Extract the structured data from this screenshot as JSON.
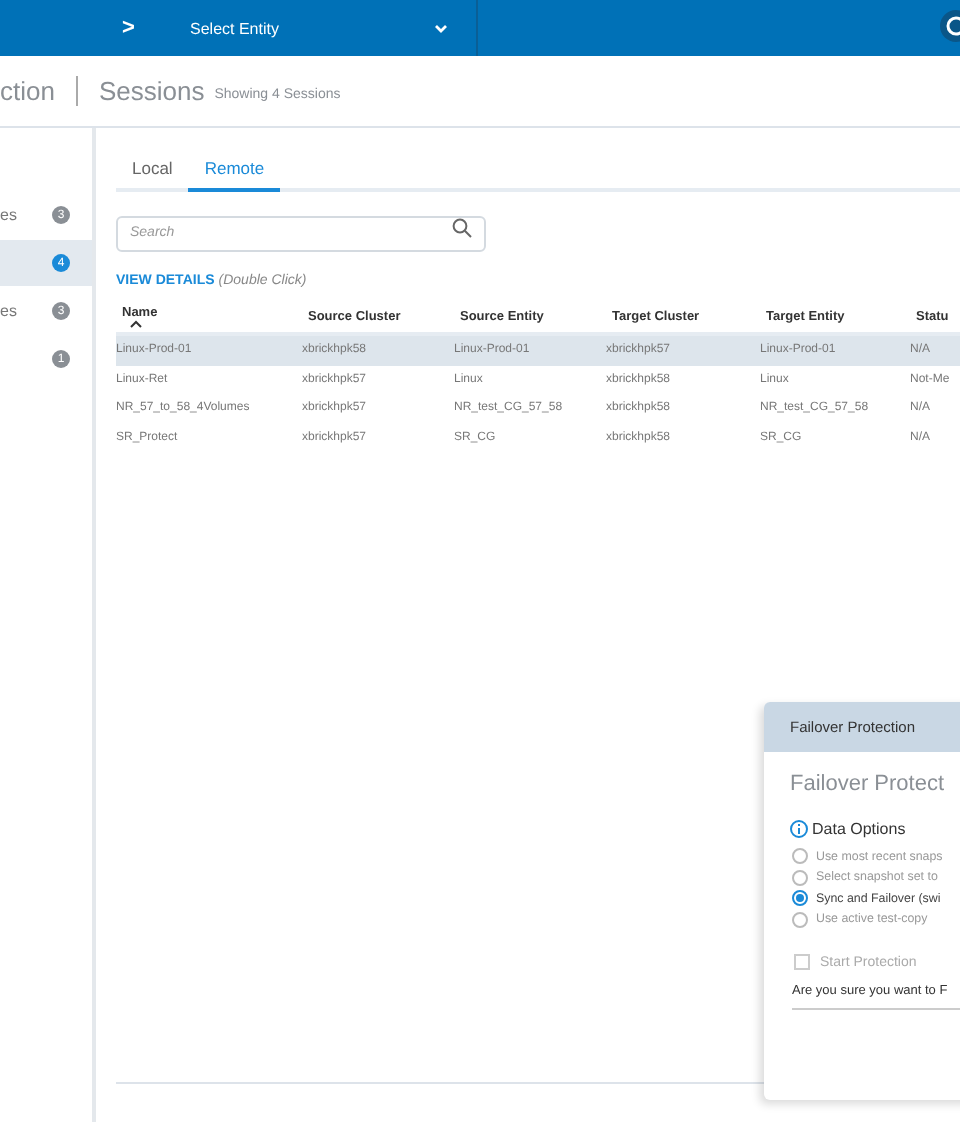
{
  "topbar": {
    "breadcrumb_separator": ">",
    "entity_select": "Select Entity"
  },
  "header": {
    "section": "ction",
    "page": "Sessions",
    "count": "Showing 4 Sessions"
  },
  "sidebar": {
    "items": [
      {
        "label": "es",
        "badge": "3",
        "selected": false
      },
      {
        "badge": "4",
        "selected": true
      },
      {
        "label": "es",
        "badge": "3",
        "selected": false
      },
      {
        "badge": "1",
        "selected": false
      }
    ]
  },
  "tabs": [
    {
      "label": "Local",
      "selected": false
    },
    {
      "label": "Remote",
      "selected": true
    }
  ],
  "search": {
    "placeholder": "Search"
  },
  "view_details": {
    "link": "VIEW DETAILS",
    "hint": "(Double Click)"
  },
  "table": {
    "columns": [
      "Name",
      "Source Cluster",
      "Source Entity",
      "Target Cluster",
      "Target Entity",
      "Statu"
    ],
    "rows": [
      {
        "cells": [
          "Linux-Prod-01",
          "xbrickhpk58",
          "Linux-Prod-01",
          "xbrickhpk57",
          "Linux-Prod-01",
          "N/A"
        ],
        "selected": true
      },
      {
        "cells": [
          "Linux-Ret",
          "xbrickhpk57",
          "Linux",
          "xbrickhpk58",
          "Linux",
          "Not-Me"
        ],
        "selected": false
      },
      {
        "cells": [
          "NR_57_to_58_4Volumes",
          "xbrickhpk57",
          "NR_test_CG_57_58",
          "xbrickhpk58",
          "NR_test_CG_57_58",
          "N/A"
        ],
        "selected": false
      },
      {
        "cells": [
          "SR_Protect",
          "xbrickhpk57",
          "SR_CG",
          "xbrickhpk58",
          "SR_CG",
          "N/A"
        ],
        "selected": false
      }
    ]
  },
  "dialog": {
    "header": "Failover Protection",
    "title": "Failover Protect",
    "section": "Data Options",
    "options": [
      {
        "label": "Use most recent snaps",
        "selected": false
      },
      {
        "label": "Select snapshot set to",
        "selected": false
      },
      {
        "label": "Sync and Failover (swi",
        "selected": true
      },
      {
        "label": "Use active test-copy",
        "selected": false
      }
    ],
    "start_protection": {
      "label": "Start Protection",
      "checked": false,
      "disabled": true
    },
    "confirm": "Are you sure you want to F"
  }
}
